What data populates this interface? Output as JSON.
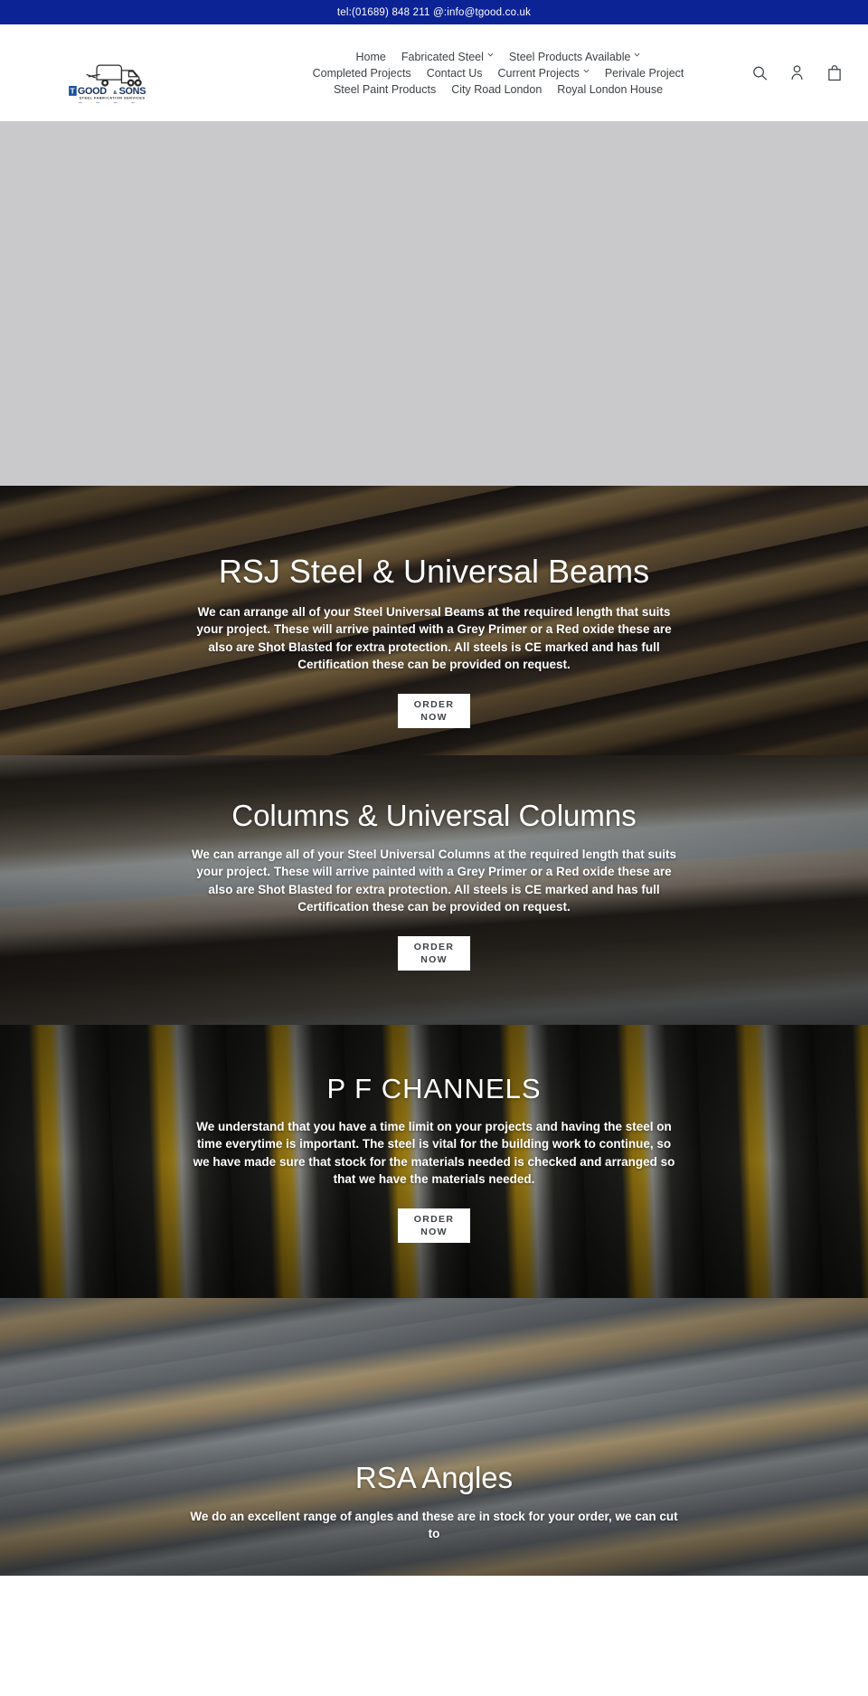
{
  "announcement": {
    "text": "tel:(01689) 848 211 @:info@tgood.co.uk"
  },
  "header": {
    "logo": {
      "name_primary": "GOOD",
      "name_amp": "&",
      "name_secondary": "SONS",
      "initial": "T",
      "tagline": "STEEL FABRICATION SERVICES"
    },
    "nav_rows": [
      [
        {
          "label": "Home",
          "has_caret": false
        },
        {
          "label": "Fabricated Steel",
          "has_caret": true
        },
        {
          "label": "Steel Products Available",
          "has_caret": true
        }
      ],
      [
        {
          "label": "Completed Projects",
          "has_caret": false
        },
        {
          "label": "Contact Us",
          "has_caret": false
        },
        {
          "label": "Current Projects",
          "has_caret": true
        },
        {
          "label": "Perivale Project",
          "has_caret": false
        }
      ],
      [
        {
          "label": "Steel Paint Products",
          "has_caret": false
        },
        {
          "label": "City Road London",
          "has_caret": false
        },
        {
          "label": "Royal London House",
          "has_caret": false
        }
      ]
    ],
    "icons": [
      {
        "name": "search-icon"
      },
      {
        "name": "account-icon"
      },
      {
        "name": "cart-icon"
      }
    ]
  },
  "slides": [
    {
      "id": "rsj",
      "title": "RSJ Steel & Universal Beams",
      "body": "We can arrange all of your Steel Universal Beams at the required length that suits your project. These will arrive painted with a Grey Primer or a Red oxide these are also are Shot Blasted for extra protection. All steels is CE marked and has full Certification these can be provided on request.",
      "button_line1": "ORDER",
      "button_line2": "NOW"
    },
    {
      "id": "columns",
      "title": "Columns & Universal Columns",
      "body": "We can arrange all of your Steel Universal Columns at the required length that suits your project. These will arrive painted with a Grey Primer or a Red oxide these are also are Shot Blasted for extra protection. All steels is CE marked and has full Certification these can be provided on request.",
      "button_line1": "ORDER",
      "button_line2": "NOW"
    },
    {
      "id": "channels",
      "title": "P F CHANNELS",
      "body_part1": "We understand that you have a time limit on your projects and having the steel on time everytime is important. ",
      "body_bold": "The steel is vital for the building work to continue",
      "body_part2": ", so we have made sure that stock for the materials needed is checked and arranged so that we have the materials needed.",
      "button_line1": "ORDER",
      "button_line2": "NOW"
    },
    {
      "id": "rsa",
      "title": "RSA Angles",
      "body": "We do an excellent range of angles and these are in stock for your order, we can cut to"
    }
  ],
  "colors": {
    "announcement_bg": "#0c2396",
    "nav_text": "#3d4246",
    "placeholder_bg": "#c9c9cc",
    "button_bg": "#ffffff"
  }
}
